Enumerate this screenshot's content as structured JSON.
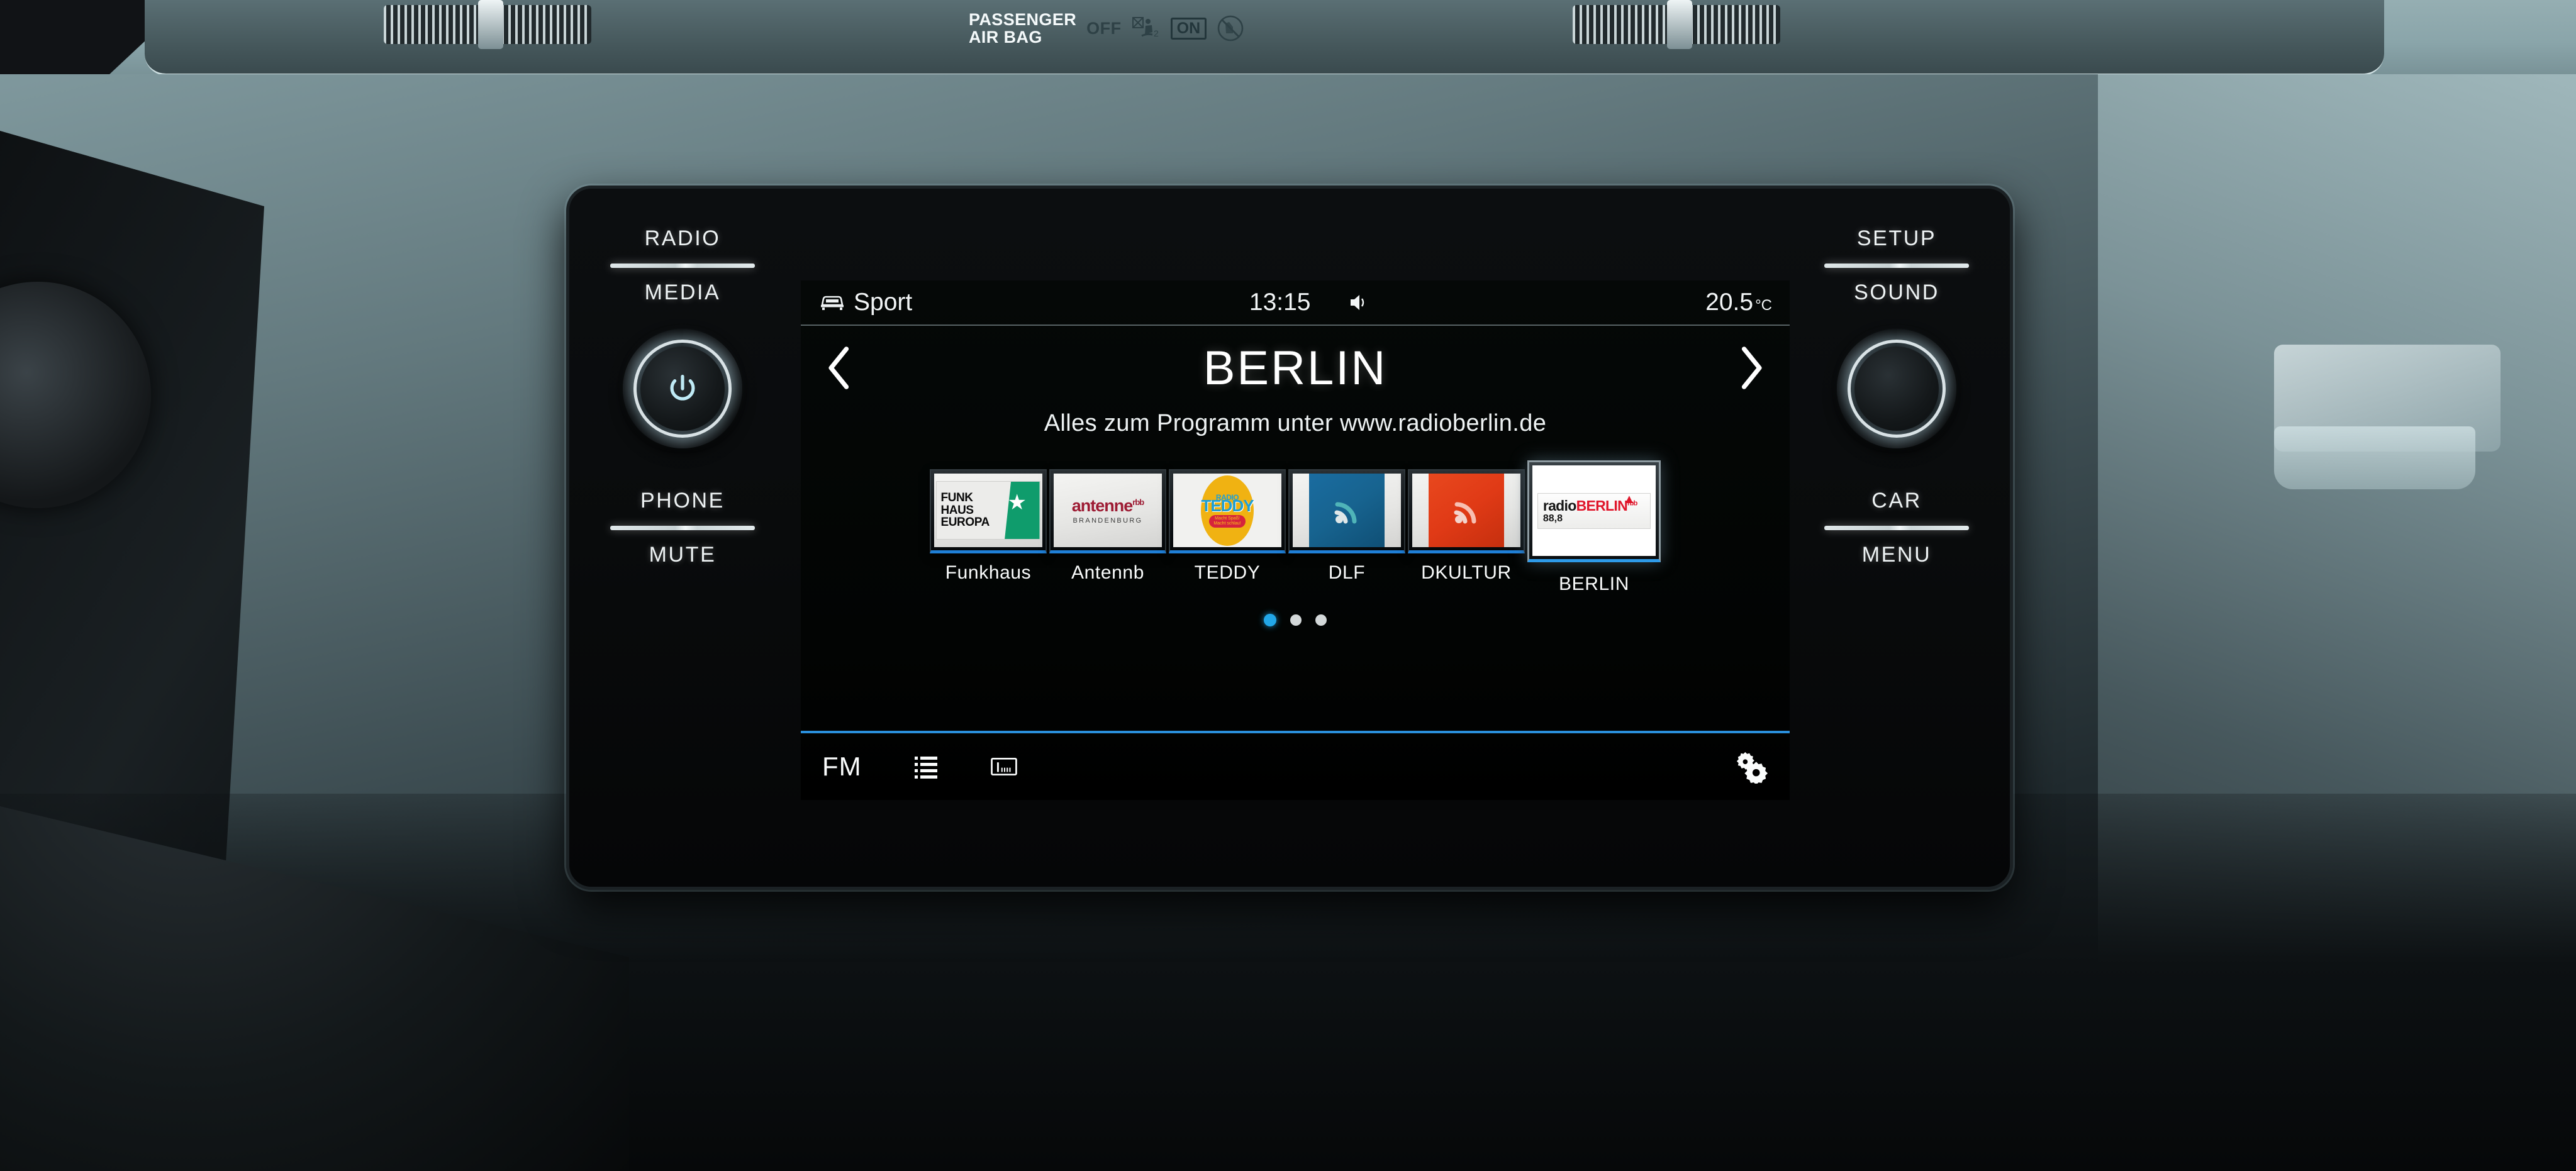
{
  "dashboard": {
    "airbag": {
      "title_line1": "PASSENGER",
      "title_line2": "AIR BAG",
      "off_label": "OFF",
      "off_icon": "passenger-airbag-off-icon",
      "on_label": "ON",
      "on_icon": "child-seat-prohibited-icon"
    }
  },
  "hardware": {
    "left": {
      "top_label": "RADIO",
      "second_label": "MEDIA",
      "knob_icon": "power-icon",
      "third_label": "PHONE",
      "bottom_label": "MUTE"
    },
    "right": {
      "top_label": "SETUP",
      "second_label": "SOUND",
      "knob_icon": "tune-knob-icon",
      "third_label": "CAR",
      "bottom_label": "MENU"
    }
  },
  "screen": {
    "statusbar": {
      "profile_icon": "car-front-icon",
      "profile": "Sport",
      "time": "13:15",
      "sound_icon": "speaker-icon",
      "temperature": "20.5",
      "temperature_unit": "°C"
    },
    "title": {
      "prev_icon": "chevron-left-icon",
      "station": "BERLIN",
      "next_icon": "chevron-right-icon"
    },
    "radiotext": "Alles zum Programm unter www.radioberlin.de",
    "presets": [
      {
        "label": "Funkhaus",
        "logo": "funkhaus-europa-logo",
        "selected": false,
        "logo_text": {
          "l1": "FUNK",
          "l2": "HAUS",
          "l3": "EUROPA"
        }
      },
      {
        "label": "Antennb",
        "logo": "antenne-brandenburg-logo",
        "selected": false,
        "logo_text": {
          "name": "antenne",
          "sup": "rbb",
          "sub": "BRANDENBURG"
        }
      },
      {
        "label": "TEDDY",
        "logo": "radio-teddy-logo",
        "selected": false,
        "logo_text": {
          "small": "RADIO",
          "big": "TEDDY",
          "tag1": "Macht Spaß!",
          "tag2": "Macht schlau!"
        }
      },
      {
        "label": "DLF",
        "logo": "deutschlandfunk-logo",
        "selected": false,
        "logo_color": "#1a6ca0"
      },
      {
        "label": "DKULTUR",
        "logo": "deutschlandfunk-kultur-logo",
        "selected": false,
        "logo_color": "#e8481e"
      },
      {
        "label": "BERLIN",
        "logo": "radioberlin-88-8-logo",
        "selected": true,
        "logo_text": {
          "p1": "radio",
          "p2": "BERLIN",
          "sup": "rbb",
          "freq": "88,8"
        }
      }
    ],
    "pager": {
      "pages": 3,
      "active": 1
    },
    "bottombar": {
      "band": "FM",
      "list_icon": "station-list-icon",
      "scale_icon": "frequency-scale-icon",
      "settings_icon": "gears-settings-icon"
    }
  },
  "colors": {
    "accent": "#2a8fdb",
    "dot_active": "#22a7e8",
    "preset_underline": "#1f7fd6",
    "screen_bg": "#010303",
    "text": "#f2f5f6"
  }
}
